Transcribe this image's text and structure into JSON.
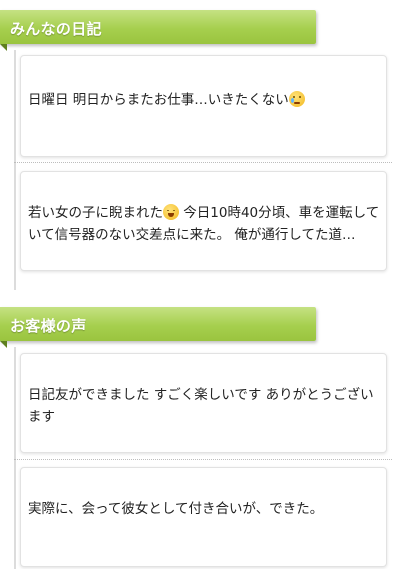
{
  "sections": [
    {
      "title": "みんなの日記",
      "items": [
        {
          "text_before": "日曜日 明日からまたお仕事…いきたくない",
          "emoji": "crying-face-icon",
          "text_after": ""
        },
        {
          "text_before": "若い女の子に睨まれた",
          "emoji": "tired-face-icon",
          "text_after": " 今日10時40分頃、車を運転していて信号器のない交差点に来た。 俺が通行してた道…"
        }
      ]
    },
    {
      "title": "お客様の声",
      "items": [
        {
          "text_before": "日記友ができました すごく楽しいです ありがとうございます",
          "emoji": "",
          "text_after": ""
        },
        {
          "text_before": "実際に、会って彼女として付き合いが、できた。",
          "emoji": "",
          "text_after": ""
        }
      ]
    }
  ]
}
